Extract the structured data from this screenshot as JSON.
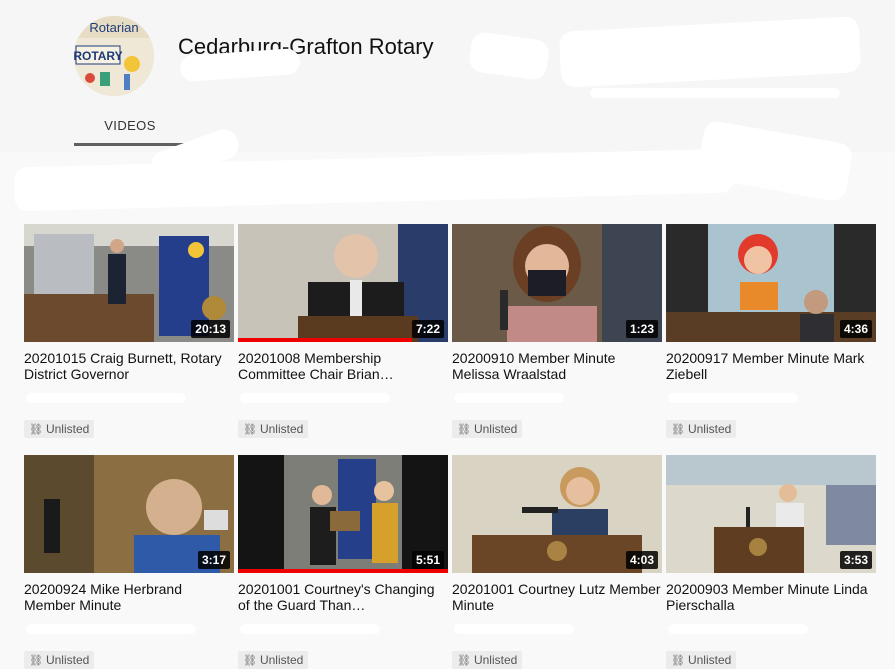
{
  "channel": {
    "name": "Cedarburg-Grafton Rotary",
    "avatar_text_top": "Rotarian",
    "avatar_text_main": "ROTARY"
  },
  "tabs": [
    {
      "label": "VIDEOS",
      "active": true
    }
  ],
  "videos": [
    {
      "title": "20201015 Craig Burnett, Rotary District Governor",
      "duration": "20:13",
      "badge": "Unlisted",
      "progress": 0,
      "icon": "link-icon"
    },
    {
      "title": "20201008 Membership Committee Chair Brian…",
      "duration": "7:22",
      "badge": "Unlisted",
      "progress": 0.83,
      "icon": "link-icon"
    },
    {
      "title": "20200910 Member Minute Melissa Wraalstad",
      "duration": "1:23",
      "badge": "Unlisted",
      "progress": 0,
      "icon": "link-icon"
    },
    {
      "title": "20200917 Member Minute Mark Ziebell",
      "duration": "4:36",
      "badge": "Unlisted",
      "progress": 0,
      "icon": "link-icon"
    },
    {
      "title": "20200924 Mike Herbrand Member Minute",
      "duration": "3:17",
      "badge": "Unlisted",
      "progress": 0,
      "icon": "link-icon"
    },
    {
      "title": "20201001 Courtney's Changing of the Guard Than…",
      "duration": "5:51",
      "badge": "Unlisted",
      "progress": 1.0,
      "icon": "link-icon"
    },
    {
      "title": "20201001 Courtney Lutz Member Minute",
      "duration": "4:03",
      "badge": "Unlisted",
      "progress": 0,
      "icon": "link-icon"
    },
    {
      "title": "20200903 Member Minute Linda Pierschalla",
      "duration": "3:53",
      "badge": "Unlisted",
      "progress": 0,
      "icon": "link-icon"
    }
  ],
  "colors": {
    "progress": "#e00000",
    "tab_underline": "#606060"
  }
}
